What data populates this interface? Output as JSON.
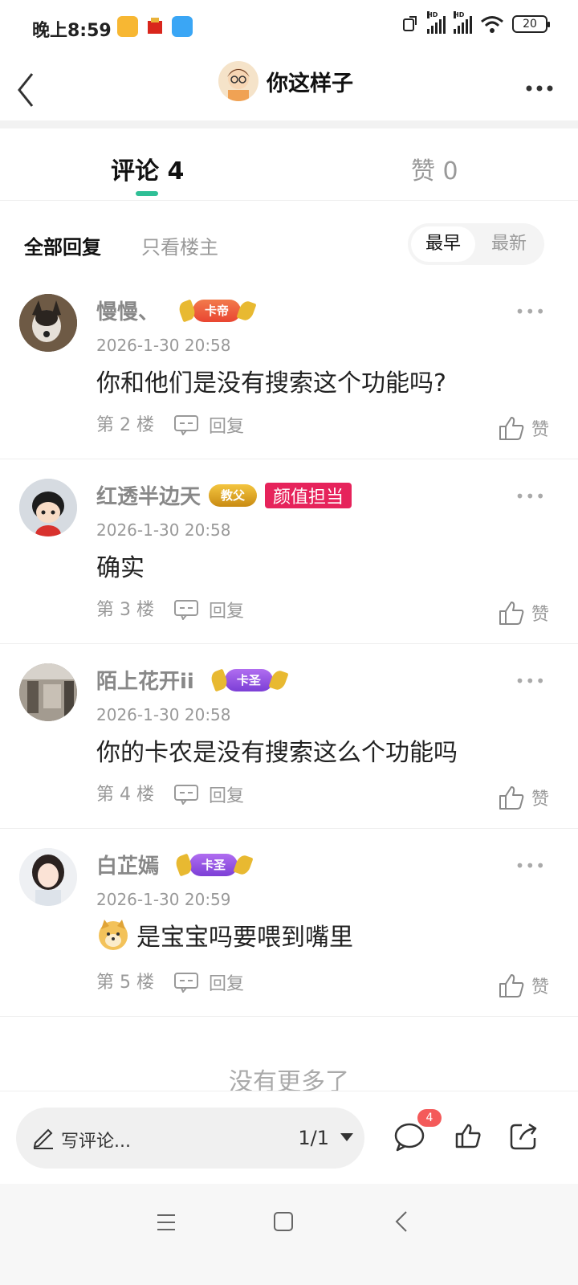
{
  "status_bar": {
    "time": "晚上8:59",
    "signal_label_1": "HD",
    "signal_label_2": "HD",
    "battery": "20"
  },
  "header": {
    "title": "你这样子"
  },
  "tabs": {
    "comments_label": "评论 4",
    "likes_label": "赞 0"
  },
  "filters": {
    "all": "全部回复",
    "owner_only": "只看楼主",
    "sort_earliest": "最早",
    "sort_newest": "最新"
  },
  "comments": [
    {
      "name": "慢慢、",
      "badge": "卡帝",
      "time": "2026-1-30 20:58",
      "text": "你和他们是没有搜索这个功能吗?",
      "floor": "第 2 楼",
      "reply": "回复",
      "like": "赞"
    },
    {
      "name": "红透半边天",
      "badge": "教父",
      "tag": "颜值担当",
      "time": "2026-1-30 20:58",
      "text": "确实",
      "floor": "第 3 楼",
      "reply": "回复",
      "like": "赞"
    },
    {
      "name": "陌上花开ii",
      "badge": "卡圣",
      "time": "2026-1-30 20:58",
      "text": "你的卡农是没有搜索这么个功能吗",
      "floor": "第 4 楼",
      "reply": "回复",
      "like": "赞"
    },
    {
      "name": "白芷嫣",
      "badge": "卡圣",
      "time": "2026-1-30 20:59",
      "text": "是宝宝吗要喂到嘴里",
      "floor": "第 5 楼",
      "reply": "回复",
      "like": "赞"
    }
  ],
  "no_more": "没有更多了",
  "bottom_bar": {
    "write_placeholder": "写评论...",
    "page_indicator": "1/1",
    "comment_count": "4"
  },
  "colors": {
    "accent_green": "#2fbf96",
    "tag_pink": "#e6235b",
    "badge_red": "#f45a5a"
  },
  "icons": [
    "back-icon",
    "more-icon",
    "reply-icon",
    "thumbs-up-icon",
    "pencil-icon",
    "comment-icon",
    "share-icon",
    "menu-icon",
    "home-icon",
    "nav-back-icon"
  ]
}
